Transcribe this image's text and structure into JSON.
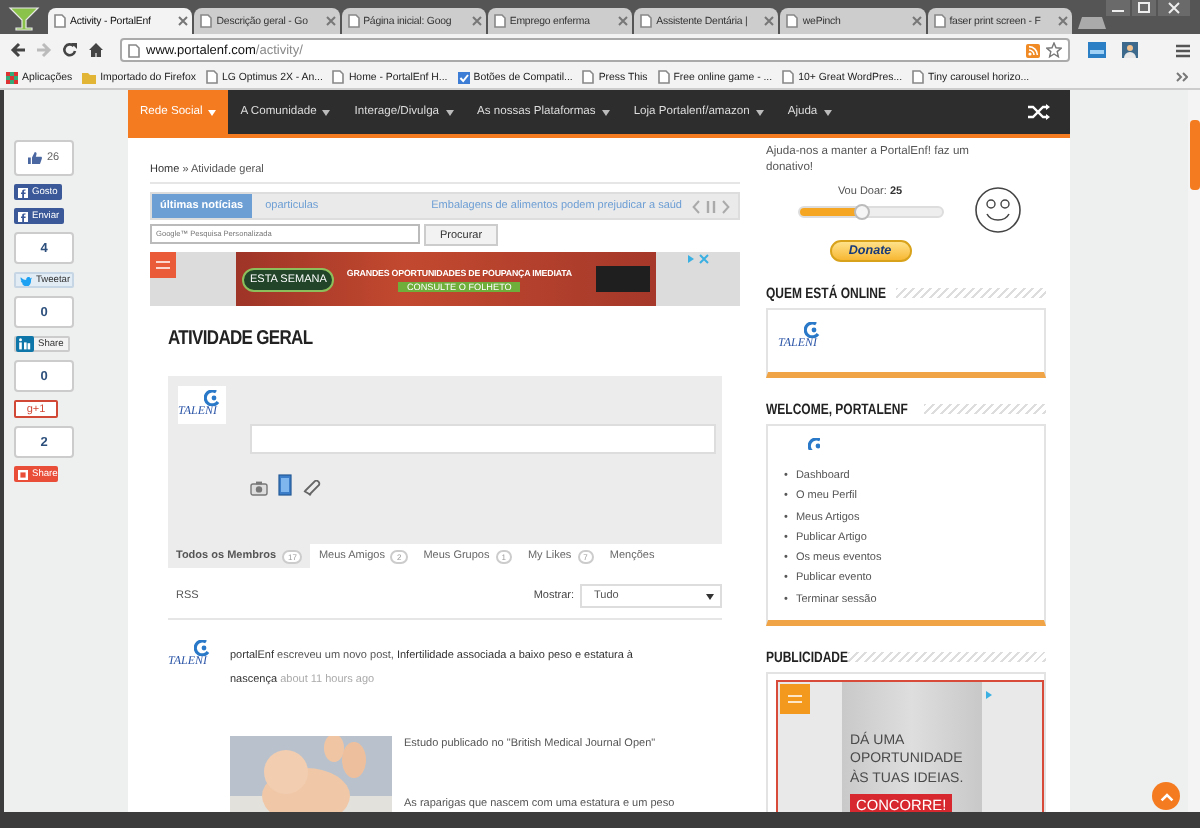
{
  "window": {
    "tabs": [
      {
        "title": "Activity - PortalEnf",
        "selected": true
      },
      {
        "title": "Descrição geral - Go",
        "selected": false
      },
      {
        "title": "Página inicial: Goog",
        "selected": false
      },
      {
        "title": "Emprego enferma",
        "selected": false
      },
      {
        "title": "Assistente Dentária |",
        "selected": false
      },
      {
        "title": "wePinch",
        "selected": false
      },
      {
        "title": "faser print screen - F",
        "selected": false
      }
    ],
    "address": {
      "host": "www.portalenf.com",
      "path": "/activity/"
    },
    "bookmarks": [
      {
        "kind": "apps",
        "label": "Aplicações"
      },
      {
        "kind": "folder",
        "label": "Importado do Firefox"
      },
      {
        "kind": "page",
        "label": "LG Optimus 2X - An..."
      },
      {
        "kind": "page",
        "label": "Home - PortalEnf H..."
      },
      {
        "kind": "check",
        "label": "Botões de Compatil..."
      },
      {
        "kind": "page",
        "label": "Press This"
      },
      {
        "kind": "page",
        "label": "Free online game - ..."
      },
      {
        "kind": "page",
        "label": "10+ Great WordPres..."
      },
      {
        "kind": "page",
        "label": "Tiny carousel horizo..."
      }
    ]
  },
  "share_bar": [
    {
      "kind": "like",
      "count": "26"
    },
    {
      "kind": "facebook",
      "label": "Gosto"
    },
    {
      "kind": "facebook",
      "label": "Enviar"
    },
    {
      "kind": "counter",
      "count": "4"
    },
    {
      "kind": "twitter",
      "label": "Tweetar"
    },
    {
      "kind": "counter",
      "count": "0"
    },
    {
      "kind": "linkedin",
      "label": "Share"
    },
    {
      "kind": "counter",
      "count": "0"
    },
    {
      "kind": "gplus",
      "label": "g+1"
    },
    {
      "kind": "counter",
      "count": "2"
    },
    {
      "kind": "share",
      "label": "Share"
    }
  ],
  "nav": {
    "items": [
      {
        "label": "Rede Social",
        "selected": true
      },
      {
        "label": "A Comunidade",
        "selected": false
      },
      {
        "label": "Interage/Divulga",
        "selected": false
      },
      {
        "label": "As nossas Plataformas",
        "selected": false
      },
      {
        "label": "Loja Portalenf/amazon",
        "selected": false
      },
      {
        "label": "Ajuda",
        "selected": false
      }
    ]
  },
  "breadcrumb": {
    "link": "Home",
    "separator": "»",
    "current": "Atividade geral"
  },
  "ticker": {
    "label": "últimas notícias",
    "category": "oparticulas",
    "headline": "Embalagens de alimentos podem prejudicar a saúd"
  },
  "search": {
    "placeholder": "Google™ Pesquisa Personalizada",
    "button": "Procurar"
  },
  "top_ad": {
    "headline": "ESTA SEMANA",
    "text": "GRANDES OPORTUNIDADES DE POUPANÇA IMEDIATA",
    "button": "CONSULTE O FOLHETO"
  },
  "page_title": "ATIVIDADE GERAL",
  "post_form": {
    "avatar": "TALENI"
  },
  "activity_tabs": [
    {
      "label": "Todos os Membros",
      "count": "17",
      "selected": true
    },
    {
      "label": "Meus Amigos",
      "count": "2",
      "selected": false
    },
    {
      "label": "Meus Grupos",
      "count": "1",
      "selected": false
    },
    {
      "label": "My Likes",
      "count": "7",
      "selected": false
    },
    {
      "label": "Menções",
      "selected": false
    }
  ],
  "feed_controls": {
    "rss": "RSS",
    "filter_label": "Mostrar:",
    "filter_value": "Tudo"
  },
  "activity": [
    {
      "avatar": "TALENI",
      "author": "portalEnf",
      "action": "escreveu um novo post,",
      "post_title": "Infertilidade associada a baixo peso e estatura à nascença",
      "time": "about 11 hours ago",
      "excerpt": [
        "Estudo publicado no \"British Medical Journal Open\"",
        "As raparigas que nascem com uma estatura e um peso"
      ]
    }
  ],
  "donation": {
    "text": "Ajuda-nos a manter a PortalEnf! faz um donativo!",
    "amount_label": "Vou Doar:",
    "amount": "25",
    "level": 0.45,
    "button": "Donate"
  },
  "widgets": [
    {
      "kind": "online",
      "title": "QUEM ESTÁ ONLINE",
      "avatar": "TALENI"
    },
    {
      "kind": "links",
      "title": "WELCOME, PORTALENF",
      "bullet": "•",
      "items": [
        "Dashboard",
        "O meu Perfil",
        "Meus Artigos",
        "Publicar Artigo",
        "Os meus eventos",
        "Publicar evento",
        "Terminar sessão"
      ]
    },
    {
      "kind": "ad",
      "title": "PUBLICIDADE",
      "lines": [
        "DÁ UMA",
        "OPORTUNIDADE",
        "ÀS TUAS IDEIAS."
      ],
      "button": "CONCORRE!"
    }
  ]
}
